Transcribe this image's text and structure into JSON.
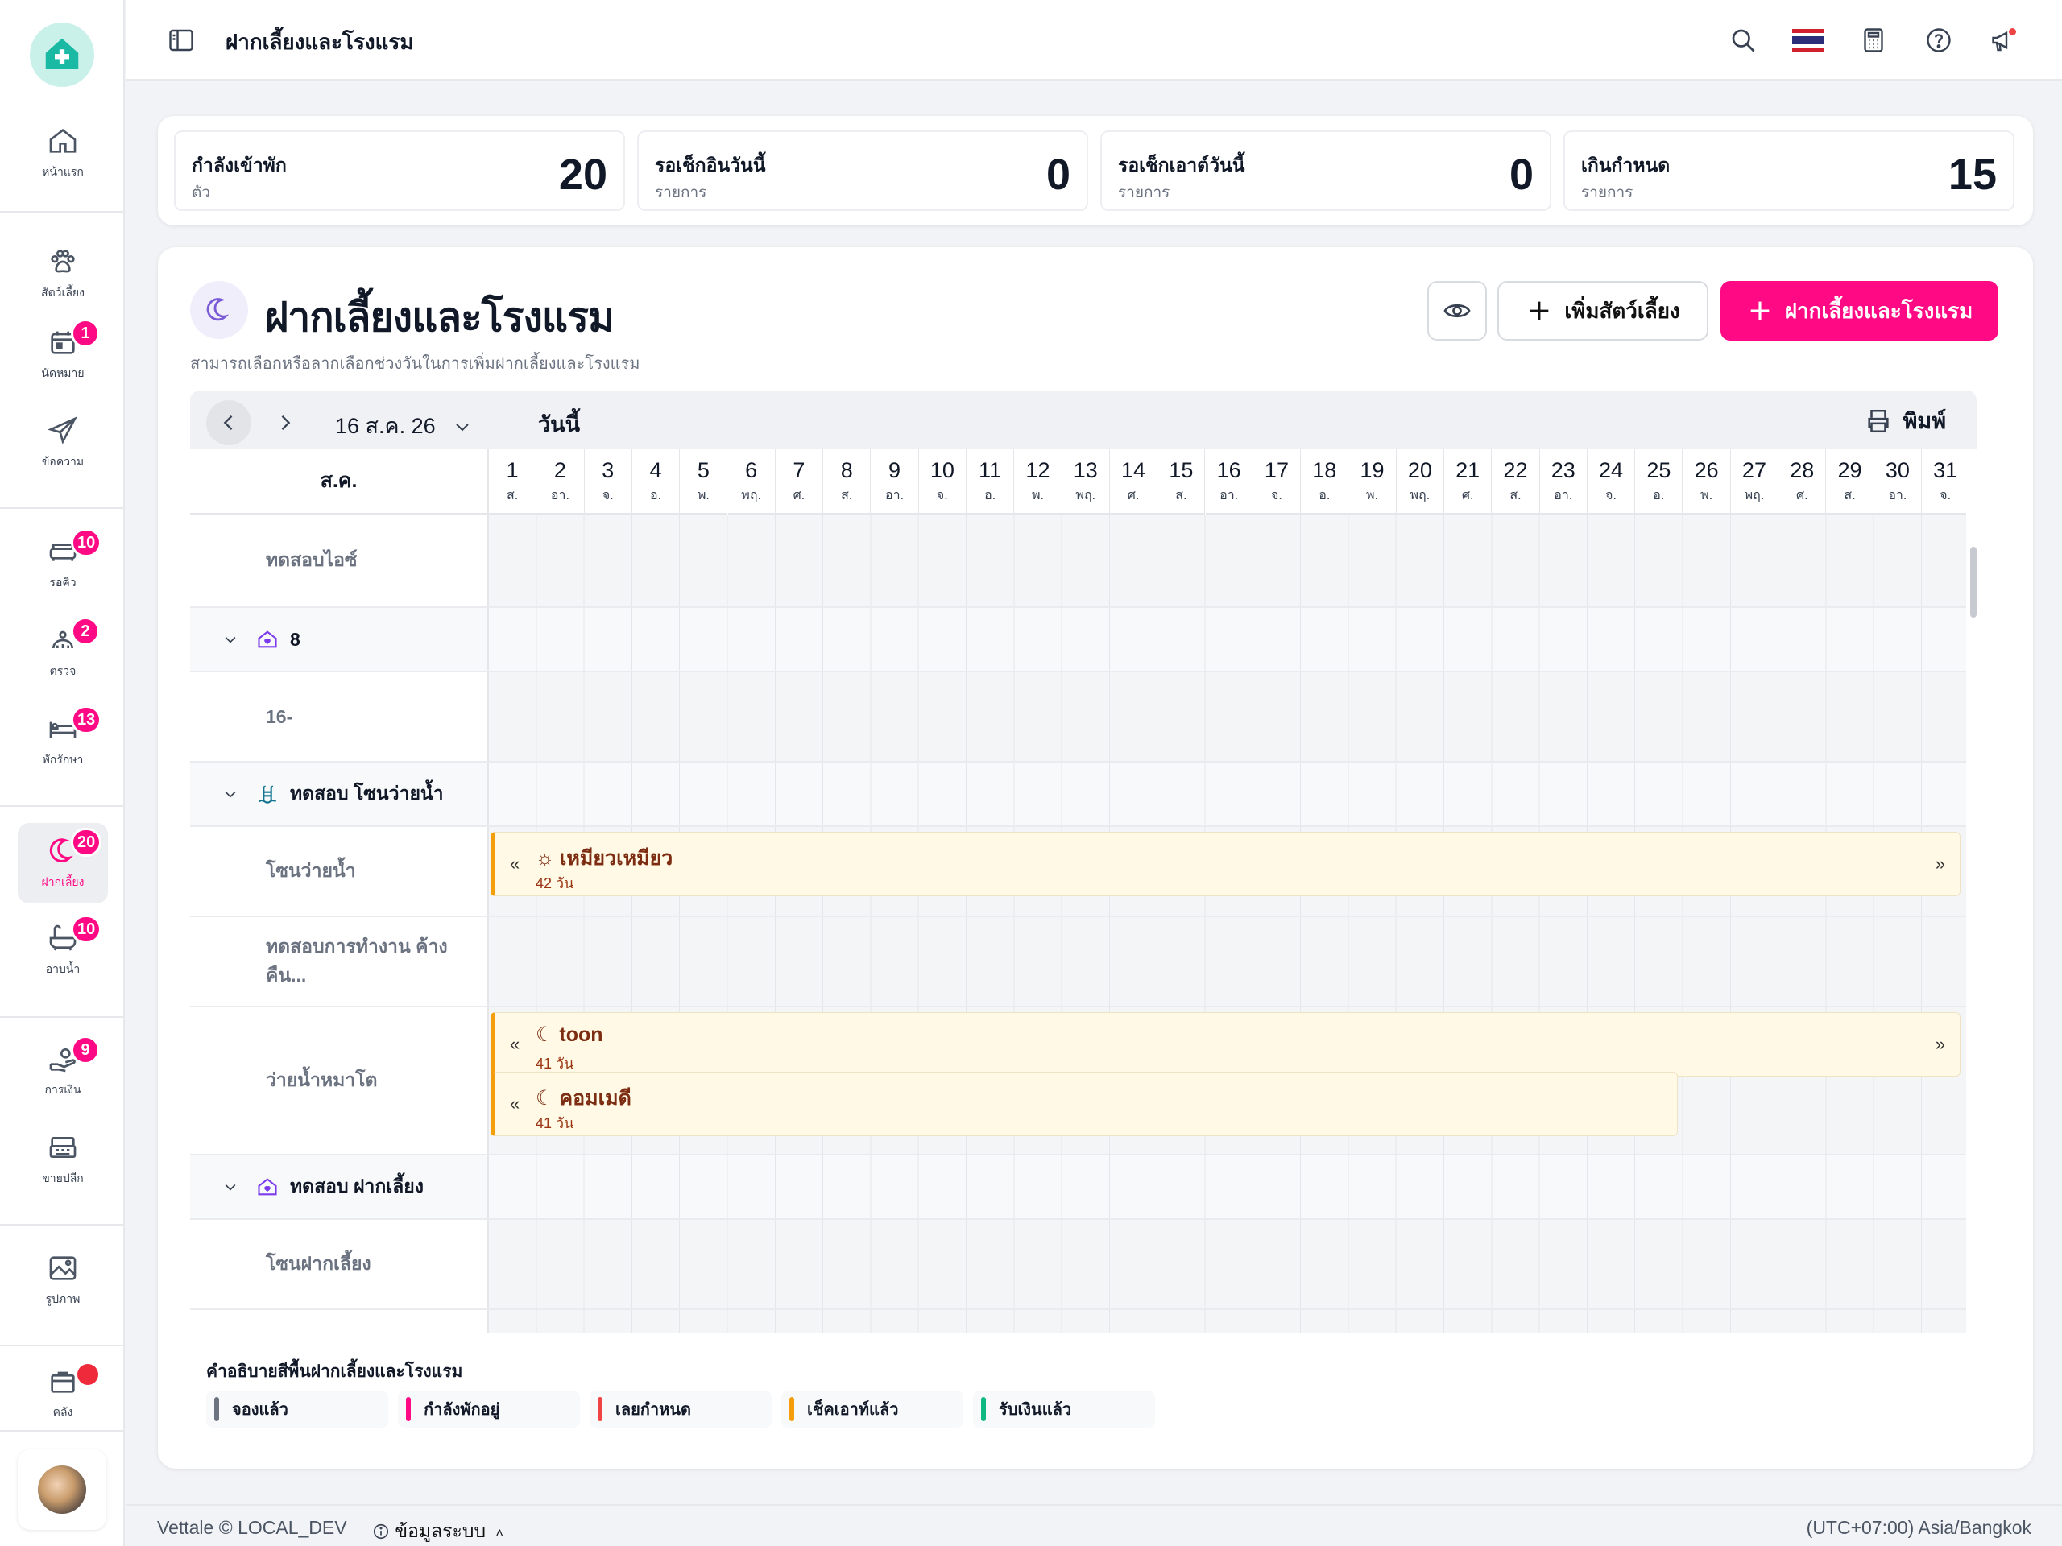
{
  "app": {
    "title": "ฝากเลี้ยงและโรงแรม"
  },
  "sidebar": {
    "items": [
      {
        "label": "หน้าแรก",
        "icon": "home-icon"
      },
      {
        "label": "สัตว์เลี้ยง",
        "icon": "paw-icon"
      },
      {
        "label": "นัดหมาย",
        "icon": "calendar-icon",
        "badge": "1"
      },
      {
        "label": "ข้อความ",
        "icon": "send-icon"
      },
      {
        "label": "รอคิว",
        "icon": "sofa-icon",
        "badge": "10"
      },
      {
        "label": "ตรวจ",
        "icon": "stethoscope-icon",
        "badge": "2"
      },
      {
        "label": "พักรักษา",
        "icon": "bed-icon",
        "badge": "13"
      },
      {
        "label": "ฝากเลี้ยง",
        "icon": "moon-icon",
        "badge": "20",
        "active": true
      },
      {
        "label": "อาบน้ำ",
        "icon": "bathtub-icon",
        "badge": "10"
      },
      {
        "label": "การเงิน",
        "icon": "money-hand-icon",
        "badge": "9"
      },
      {
        "label": "ขายปลีก",
        "icon": "cash-register-icon"
      },
      {
        "label": "รูปภาพ",
        "icon": "image-icon"
      },
      {
        "label": "คลัง",
        "icon": "box-icon"
      }
    ]
  },
  "stats": [
    {
      "label": "กำลังเข้าพัก",
      "unit": "ตัว",
      "value": "20"
    },
    {
      "label": "รอเช็กอินวันนี้",
      "unit": "รายการ",
      "value": "0"
    },
    {
      "label": "รอเช็กเอาต์วันนี้",
      "unit": "รายการ",
      "value": "0"
    },
    {
      "label": "เกินกำหนด",
      "unit": "รายการ",
      "value": "15"
    }
  ],
  "page": {
    "title": "ฝากเลี้ยงและโรงแรม",
    "subtitle": "สามารถเลือกหรือลากเลือกช่วงวันในการเพิ่มฝากเลี้ยงและโรงแรม",
    "add_pet_label": "เพิ่มสัตว์เลี้ยง",
    "add_boarding_label": "ฝากเลี้ยงและโรงแรม"
  },
  "calendar": {
    "date_label": "16 ส.ค. 26",
    "today_label": "วันนี้",
    "print_label": "พิมพ์",
    "month_label": "ส.ค.",
    "days": [
      {
        "n": "1",
        "w": "ส."
      },
      {
        "n": "2",
        "w": "อา."
      },
      {
        "n": "3",
        "w": "จ."
      },
      {
        "n": "4",
        "w": "อ."
      },
      {
        "n": "5",
        "w": "พ."
      },
      {
        "n": "6",
        "w": "พฤ."
      },
      {
        "n": "7",
        "w": "ศ."
      },
      {
        "n": "8",
        "w": "ส."
      },
      {
        "n": "9",
        "w": "อา."
      },
      {
        "n": "10",
        "w": "จ."
      },
      {
        "n": "11",
        "w": "อ."
      },
      {
        "n": "12",
        "w": "พ."
      },
      {
        "n": "13",
        "w": "พฤ."
      },
      {
        "n": "14",
        "w": "ศ."
      },
      {
        "n": "15",
        "w": "ส."
      },
      {
        "n": "16",
        "w": "อา."
      },
      {
        "n": "17",
        "w": "จ."
      },
      {
        "n": "18",
        "w": "อ."
      },
      {
        "n": "19",
        "w": "พ."
      },
      {
        "n": "20",
        "w": "พฤ."
      },
      {
        "n": "21",
        "w": "ศ."
      },
      {
        "n": "22",
        "w": "ส."
      },
      {
        "n": "23",
        "w": "อา."
      },
      {
        "n": "24",
        "w": "จ."
      },
      {
        "n": "25",
        "w": "อ."
      },
      {
        "n": "26",
        "w": "พ."
      },
      {
        "n": "27",
        "w": "พฤ."
      },
      {
        "n": "28",
        "w": "ศ."
      },
      {
        "n": "29",
        "w": "ส."
      },
      {
        "n": "30",
        "w": "อา."
      },
      {
        "n": "31",
        "w": "จ."
      }
    ],
    "rows": {
      "r1": "ทดสอบไอซ์",
      "g1": "8",
      "r2": "16-",
      "g2": "ทดสอบ โซนว่ายน้ำ",
      "r3": "โซนว่ายน้ำ",
      "r4": "ทดสอบการทำงาน ค้างคืน...",
      "r5": "ว่ายน้ำหมาโต",
      "g3": "ทดสอบ ฝากเลี้ยง",
      "r6": "โซนฝากเลี้ยง"
    },
    "bookings": {
      "b1": {
        "name": "เหมียวเหมียว",
        "duration": "42 วัน"
      },
      "b2": {
        "name": "toon",
        "duration": "41 วัน"
      },
      "b3": {
        "name": "คอมเมดี",
        "duration": "41 วัน"
      }
    }
  },
  "legend": {
    "title": "คำอธิบายสีพื้นฝากเลี้ยงและโรงแรม",
    "items": [
      {
        "label": "จองแล้ว",
        "color": "#6b7280"
      },
      {
        "label": "กำลังพักอยู่",
        "color": "#ff0a84"
      },
      {
        "label": "เลยกำหนด",
        "color": "#ef4444"
      },
      {
        "label": "เช็คเอาท์แล้ว",
        "color": "#f59e0b"
      },
      {
        "label": "รับเงินแล้ว",
        "color": "#10b981"
      }
    ]
  },
  "footer": {
    "left": "Vettale © LOCAL_DEV",
    "system_info": "ข้อมูลระบบ",
    "timezone": "(UTC+07:00) Asia/Bangkok"
  },
  "colors": {
    "accent": "#ff0a84",
    "booking_border": "#f59e0b",
    "booking_bg": "#fff9e5"
  }
}
